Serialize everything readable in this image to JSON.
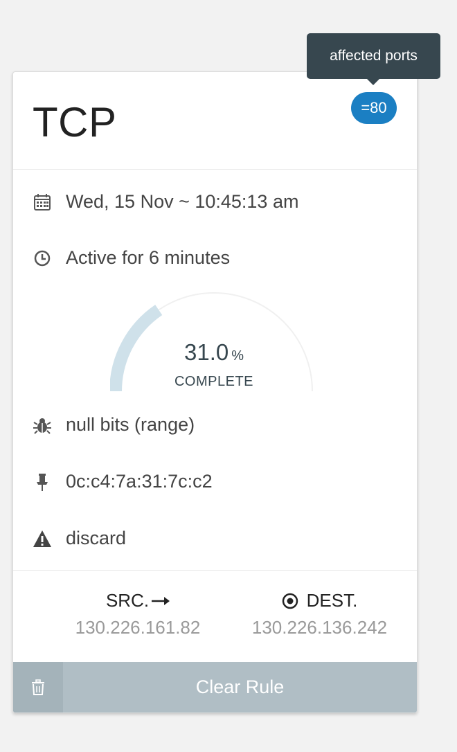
{
  "card": {
    "title": "TCP",
    "badge": "=80",
    "tooltip": "affected ports",
    "date": "Wed, 15 Nov ~ 10:45:13 am",
    "active": "Active for 6 minutes",
    "progress": {
      "value": "31.0",
      "percent_sign": "%",
      "label": "COMPLETE",
      "fraction": 0.31
    },
    "attack": "null bits (range)",
    "mac": "0c:c4:7a:31:7c:c2",
    "action": "discard",
    "src": {
      "label": "SRC.",
      "ip": "130.226.161.82"
    },
    "dest": {
      "label": "DEST.",
      "ip": "130.226.136.242"
    },
    "clear_label": "Clear Rule"
  },
  "icons": {
    "calendar": "calendar-icon",
    "clock": "clock-icon",
    "bug": "bug-icon",
    "pin": "pin-icon",
    "warning": "warning-icon",
    "arrow": "arrow-right-icon",
    "target": "target-icon",
    "trash": "trash-icon"
  },
  "colors": {
    "accent": "#1b7fc3",
    "tooltip": "#37474f",
    "footer": "#b0bec5",
    "gauge_fill": "#cfe1ea"
  }
}
